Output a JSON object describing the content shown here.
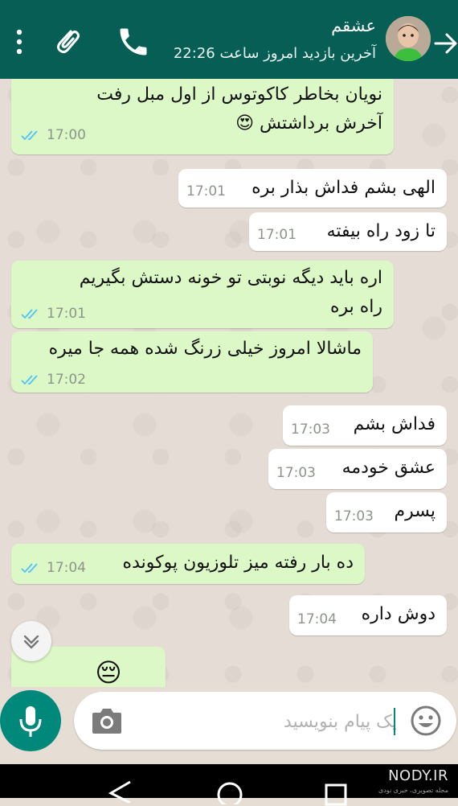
{
  "header": {
    "contact_name": "عشقم",
    "last_seen": "آخرین بازدید امروز ساعت 22:26",
    "icons": [
      "menu-icon",
      "attach-icon",
      "call-icon",
      "avatar",
      "back-arrow-icon"
    ],
    "background_color": "#075e54"
  },
  "messages": [
    {
      "direction": "out",
      "lines": [
        "نویان بخاطر کاکوتوس از اول مبل رفت",
        "آخرش برداشتش 😍"
      ],
      "time": "17:00",
      "status": "read"
    },
    {
      "direction": "in",
      "lines": [
        "الهی بشم فداش بذار بره"
      ],
      "time": "17:01"
    },
    {
      "direction": "in",
      "lines": [
        "تا زود راه بیفته"
      ],
      "time": "17:01"
    },
    {
      "direction": "out",
      "lines": [
        "اره باید دیگه نوبتی تو خونه دستش بگیریم",
        "راه بره"
      ],
      "time": "17:01",
      "status": "read"
    },
    {
      "direction": "out",
      "lines": [
        "ماشالا امروز خیلی زرنگ شده همه جا میره"
      ],
      "time": "17:02",
      "status": "read"
    },
    {
      "direction": "in",
      "lines": [
        "فداش بشم"
      ],
      "time": "17:03"
    },
    {
      "direction": "in",
      "lines": [
        "عشق خودمه"
      ],
      "time": "17:03"
    },
    {
      "direction": "in",
      "lines": [
        "پسرم"
      ],
      "time": "17:03"
    },
    {
      "direction": "out",
      "lines": [
        "ده بار رفته میز تلوزیون پوکونده"
      ],
      "time": "17:04",
      "status": "read"
    },
    {
      "direction": "in",
      "lines": [
        "دوش داره"
      ],
      "time": "17:04"
    },
    {
      "direction": "out",
      "lines": [
        "😔"
      ],
      "time": "",
      "status": ""
    }
  ],
  "input": {
    "placeholder": "یک پیام بنویسید",
    "value": ""
  },
  "watermark": {
    "text": "NODY.IR",
    "subtext": "مجله تصویری، خبری نودی"
  },
  "colors": {
    "outgoing_bubble": "#dcf8c6",
    "incoming_bubble": "#ffffff",
    "read_ticks": "#4fc3f7",
    "accent": "#00897b"
  }
}
